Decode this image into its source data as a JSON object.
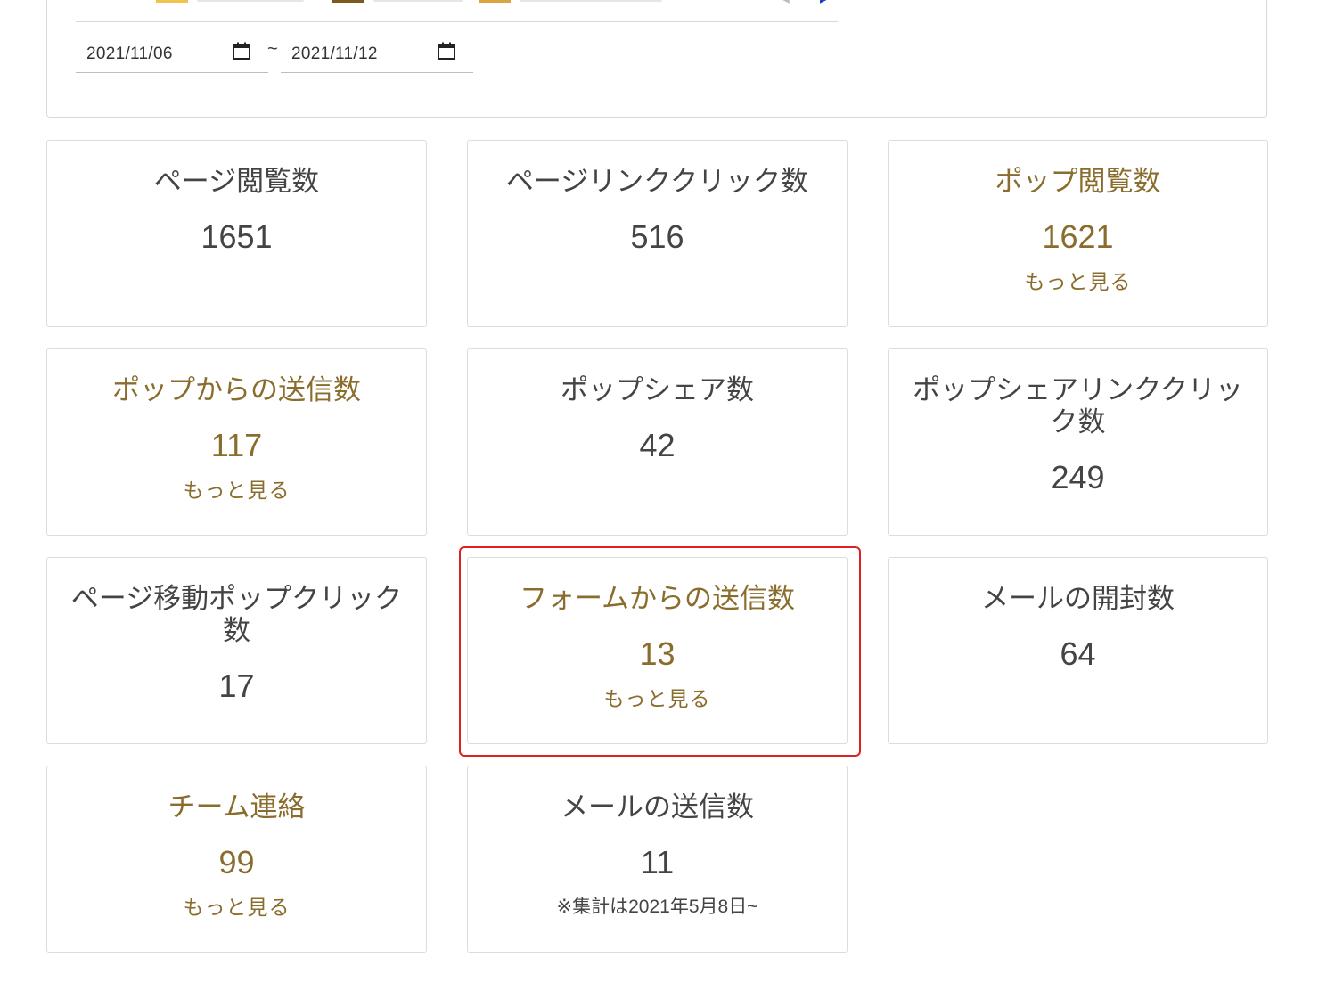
{
  "date_range": {
    "start": "2021/11/06",
    "separator": "~",
    "end": "2021/11/12"
  },
  "colors": {
    "gold_text": "#8a6d2c",
    "plain_text": "#444444",
    "highlight_border": "#e02020",
    "legend_swatch_1": "#f2c14e",
    "legend_swatch_2": "#7a5a1e",
    "legend_swatch_3": "#d9a441"
  },
  "cards": [
    {
      "title": "ページ閲覧数",
      "value": "1651"
    },
    {
      "title": "ページリンククリック数",
      "value": "516"
    },
    {
      "title": "ポップ閲覧数",
      "value": "1621",
      "link": "もっと見る"
    },
    {
      "title": "ポップからの送信数",
      "value": "117",
      "link": "もっと見る"
    },
    {
      "title": "ポップシェア数",
      "value": "42"
    },
    {
      "title": "ポップシェアリンククリック数",
      "value": "249"
    },
    {
      "title": "ページ移動ポップクリック数",
      "value": "17"
    },
    {
      "title": "フォームからの送信数",
      "value": "13",
      "link": "もっと見る"
    },
    {
      "title": "メールの開封数",
      "value": "64"
    },
    {
      "title": "チーム連絡",
      "value": "99",
      "link": "もっと見る"
    },
    {
      "title": "メールの送信数",
      "value": "11",
      "note": "※集計は2021年5月8日~"
    }
  ]
}
